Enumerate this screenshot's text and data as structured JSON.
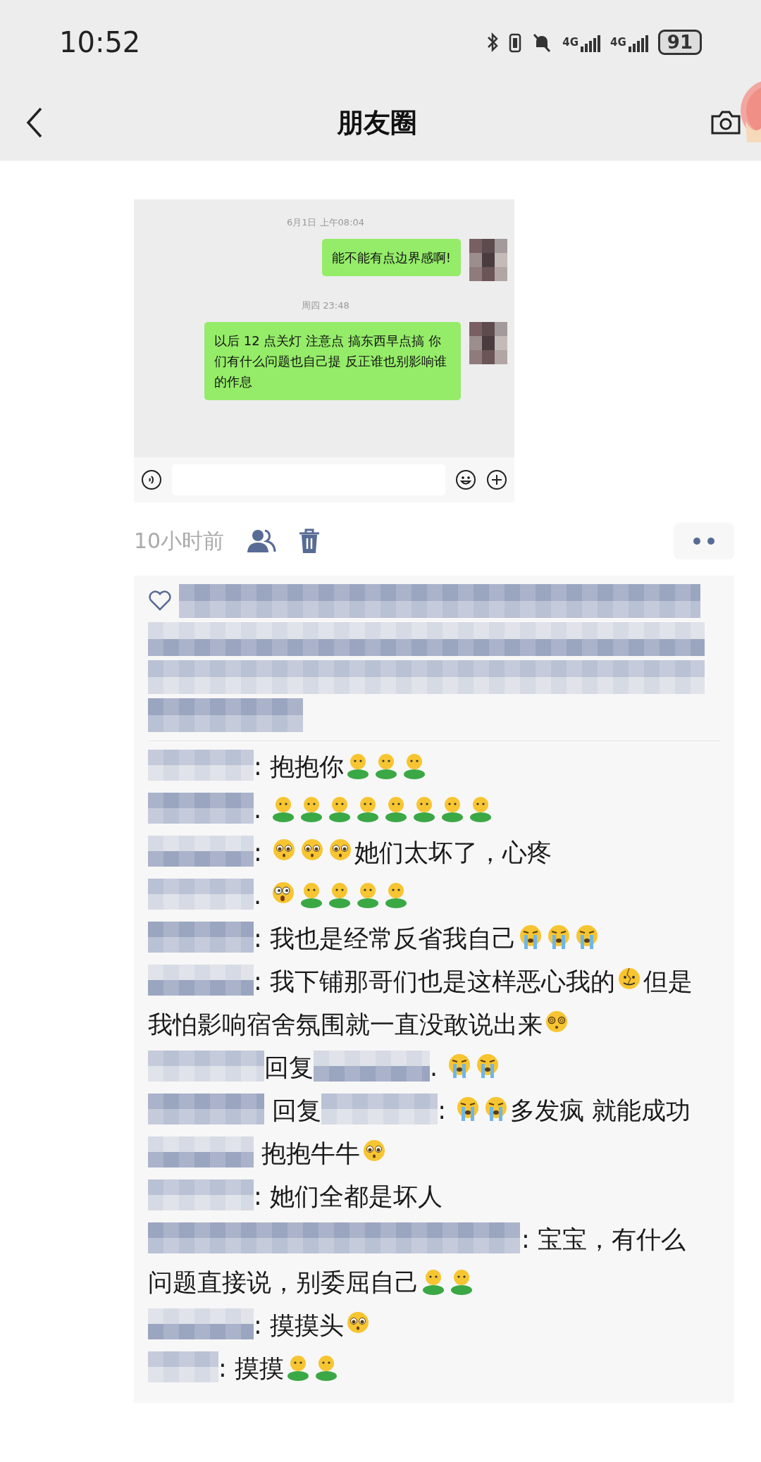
{
  "status_bar": {
    "time": "10:52",
    "network_labels": [
      "4G",
      "4G"
    ],
    "battery": "91"
  },
  "nav": {
    "title": "朋友圈"
  },
  "chat_screenshot": {
    "messages": [
      {
        "kind": "time",
        "text": "6月1日 上午08:04"
      },
      {
        "kind": "bubble",
        "text": "能不能有点边界感啊!"
      },
      {
        "kind": "time",
        "text": "周四 23:48"
      },
      {
        "kind": "bubble",
        "text": "以后 12 点关灯 注意点 搞东西早点搞 你们有什么问题也自己提 反正谁也别影响谁的作息"
      }
    ]
  },
  "post_meta": {
    "time": "10小时前"
  },
  "likes": {
    "kind": "mosaic"
  },
  "comments": [
    {
      "parts": [
        {
          "kind": "mosaic"
        },
        {
          "kind": "text",
          "text": ": 抱抱你"
        },
        {
          "kind": "hug"
        },
        {
          "kind": "hug"
        },
        {
          "kind": "hug"
        }
      ]
    },
    {
      "parts": [
        {
          "kind": "mosaic"
        },
        {
          "kind": "text",
          "text": ". "
        },
        {
          "kind": "hug"
        },
        {
          "kind": "hug"
        },
        {
          "kind": "hug"
        },
        {
          "kind": "hug"
        },
        {
          "kind": "hug"
        },
        {
          "kind": "hug"
        },
        {
          "kind": "hug"
        },
        {
          "kind": "hug"
        }
      ]
    },
    {
      "parts": [
        {
          "kind": "mosaic"
        },
        {
          "kind": "text",
          "text": ": "
        },
        {
          "kind": "pleading"
        },
        {
          "kind": "pleading"
        },
        {
          "kind": "pleading"
        },
        {
          "kind": "text",
          "text": "她们太坏了，心疼"
        }
      ]
    },
    {
      "parts": [
        {
          "kind": "mosaic"
        },
        {
          "kind": "text",
          "text": ". "
        },
        {
          "kind": "surprised"
        },
        {
          "kind": "hug"
        },
        {
          "kind": "hug"
        },
        {
          "kind": "hug"
        },
        {
          "kind": "hug"
        }
      ]
    },
    {
      "parts": [
        {
          "kind": "mosaic"
        },
        {
          "kind": "text",
          "text": ": 我也是经常反省我自己"
        },
        {
          "kind": "crying"
        },
        {
          "kind": "crying"
        },
        {
          "kind": "crying"
        }
      ]
    },
    {
      "parts": [
        {
          "kind": "mosaic"
        },
        {
          "kind": "text",
          "text": ": 我下铺那哥们也是这样恶心我的"
        },
        {
          "kind": "cracked"
        },
        {
          "kind": "text",
          "text": "但是"
        },
        {
          "kind": "linebreak"
        },
        {
          "kind": "text",
          "text": "我怕影响宿舍氛围就一直没敢说出来"
        },
        {
          "kind": "dizzy"
        }
      ]
    },
    {
      "parts": [
        {
          "kind": "longmosaic"
        },
        {
          "kind": "text",
          "text": "回复"
        },
        {
          "kind": "longmosaic"
        },
        {
          "kind": "text",
          "text": ". "
        },
        {
          "kind": "crying"
        },
        {
          "kind": "crying"
        }
      ]
    },
    {
      "parts": [
        {
          "kind": "longmosaic"
        },
        {
          "kind": "text",
          "text": " 回复"
        },
        {
          "kind": "longmosaic"
        },
        {
          "kind": "text",
          "text": ": "
        },
        {
          "kind": "crying"
        },
        {
          "kind": "crying"
        },
        {
          "kind": "text",
          "text": "多发疯 就能成功"
        }
      ]
    },
    {
      "parts": [
        {
          "kind": "mosaic"
        },
        {
          "kind": "text",
          "text": " 抱抱牛牛"
        },
        {
          "kind": "pleading"
        }
      ]
    },
    {
      "parts": [
        {
          "kind": "mosaic"
        },
        {
          "kind": "text",
          "text": ": 她们全都是坏人"
        }
      ]
    },
    {
      "parts": [
        {
          "kind": "widemosaic"
        },
        {
          "kind": "text",
          "text": ": 宝宝，有什么"
        },
        {
          "kind": "linebreak"
        },
        {
          "kind": "text",
          "text": "问题直接说，别委屈自己"
        },
        {
          "kind": "hug"
        },
        {
          "kind": "hug"
        }
      ]
    },
    {
      "parts": [
        {
          "kind": "mosaic"
        },
        {
          "kind": "text",
          "text": ": 摸摸头"
        },
        {
          "kind": "pleading"
        }
      ]
    },
    {
      "parts": [
        {
          "kind": "shortmosaic"
        },
        {
          "kind": "text",
          "text": ": 摸摸"
        },
        {
          "kind": "hug"
        },
        {
          "kind": "hug"
        }
      ]
    }
  ]
}
